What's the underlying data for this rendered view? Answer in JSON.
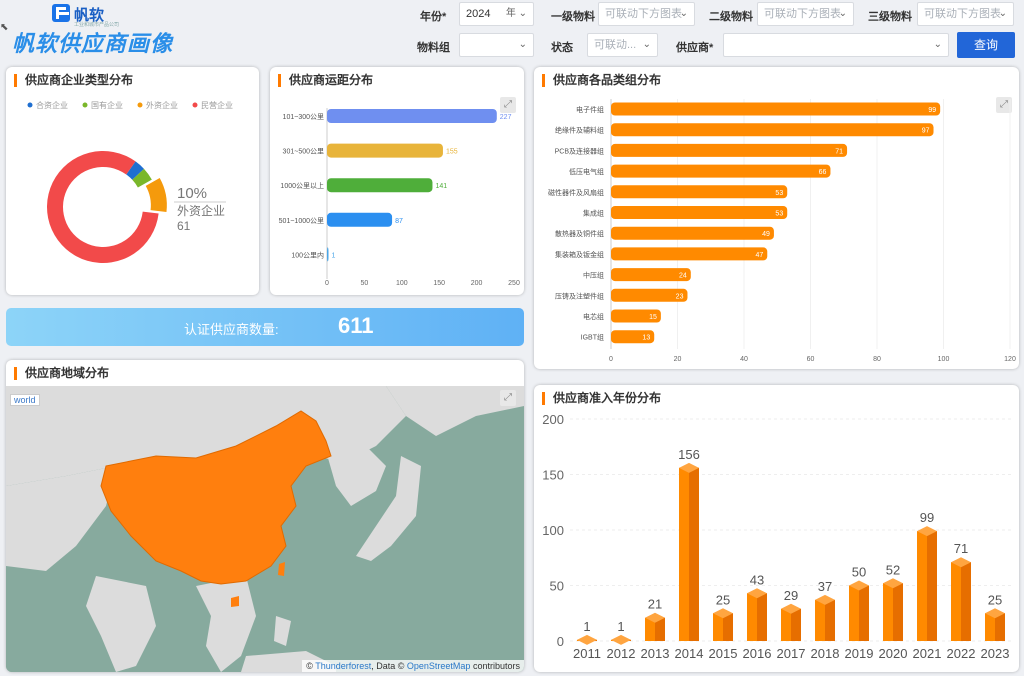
{
  "brand": {
    "name": "帆软",
    "sub": "工业和城市产品公司",
    "title": "帆软供应商画像"
  },
  "filters": {
    "year_label": "年份*",
    "year_value": "2024",
    "year_unit": "年",
    "cat1_label": "一级物料",
    "cat1_placeholder": "可联动下方图表",
    "cat2_label": "二级物料",
    "cat2_placeholder": "可联动下方图表",
    "cat3_label": "三级物料",
    "cat3_placeholder": "可联动下方图表",
    "group_label": "物料组",
    "group_value": "",
    "status_label": "状态",
    "status_placeholder": "可联动...",
    "supplier_label": "供应商*",
    "supplier_value": "",
    "query_label": "查询"
  },
  "panels": {
    "type_title": "供应商企业类型分布",
    "distance_title": "供应商运距分布",
    "category_title": "供应商各品类组分布",
    "region_title": "供应商地域分布",
    "year_title": "供应商准入年份分布"
  },
  "banner": {
    "label": "认证供应商数量:",
    "value": "611"
  },
  "map": {
    "tag": "world",
    "attr_prefix": "©",
    "attr_tf": "Thunderforest",
    "attr_mid": ", Data ©",
    "attr_osm": "OpenStreetMap",
    "attr_suffix": "contributors"
  },
  "chart_data": [
    {
      "id": "type",
      "type": "pie",
      "legend": [
        {
          "name": "合资企业",
          "color": "#1f6fd0"
        },
        {
          "name": "国有企业",
          "color": "#7ab72a"
        },
        {
          "name": "外资企业",
          "color": "#f59a0c"
        },
        {
          "name": "民营企业",
          "color": "#f24a4a"
        }
      ],
      "slices": [
        {
          "name": "合资企业",
          "percent": 3.2,
          "color": "#1f6fd0"
        },
        {
          "name": "国有企业",
          "percent": 3.8,
          "color": "#7ab72a"
        },
        {
          "name": "外资企业",
          "percent": 10,
          "value": 61,
          "color": "#f59a0c"
        },
        {
          "name": "民营企业",
          "percent": 83,
          "color": "#f24a4a"
        }
      ],
      "callout": {
        "percent": "10%",
        "name": "外资企业",
        "value": "61"
      }
    },
    {
      "id": "distance",
      "type": "bar",
      "orientation": "horizontal",
      "categories": [
        "101~300公里",
        "301~500公里",
        "1000公里以上",
        "501~1000公里",
        "100公里内"
      ],
      "values": [
        227,
        155,
        141,
        87,
        1
      ],
      "colors": [
        "#6f8ff0",
        "#e8b43a",
        "#4fae3a",
        "#2b8ff0",
        "#4aa6e8"
      ],
      "xticks": [
        0,
        50,
        100,
        150,
        200,
        250
      ],
      "xlim": [
        0,
        250
      ]
    },
    {
      "id": "category",
      "type": "bar",
      "orientation": "horizontal",
      "categories": [
        "电子件组",
        "绝缘件及辅料组",
        "PCB及连接器组",
        "低压电气组",
        "磁性器件及风扇组",
        "集成组",
        "散热器及铜件组",
        "集装箱及钣金组",
        "中压组",
        "压铸及注塑件组",
        "电芯组",
        "IGBT组"
      ],
      "values": [
        99,
        97,
        71,
        66,
        53,
        53,
        49,
        47,
        24,
        23,
        15,
        13
      ],
      "color": "#ff8a00",
      "xticks": [
        0,
        20,
        40,
        60,
        80,
        100,
        120
      ],
      "xlim": [
        0,
        120
      ]
    },
    {
      "id": "year",
      "type": "bar",
      "categories": [
        "2011",
        "2012",
        "2013",
        "2014",
        "2015",
        "2016",
        "2017",
        "2018",
        "2019",
        "2020",
        "2021",
        "2022",
        "2023"
      ],
      "values": [
        1,
        1,
        21,
        156,
        25,
        43,
        29,
        37,
        50,
        52,
        99,
        71,
        25
      ],
      "color": "#ff8a00",
      "yticks": [
        0,
        50,
        100,
        150,
        200
      ],
      "ylim": [
        0,
        200
      ]
    }
  ]
}
